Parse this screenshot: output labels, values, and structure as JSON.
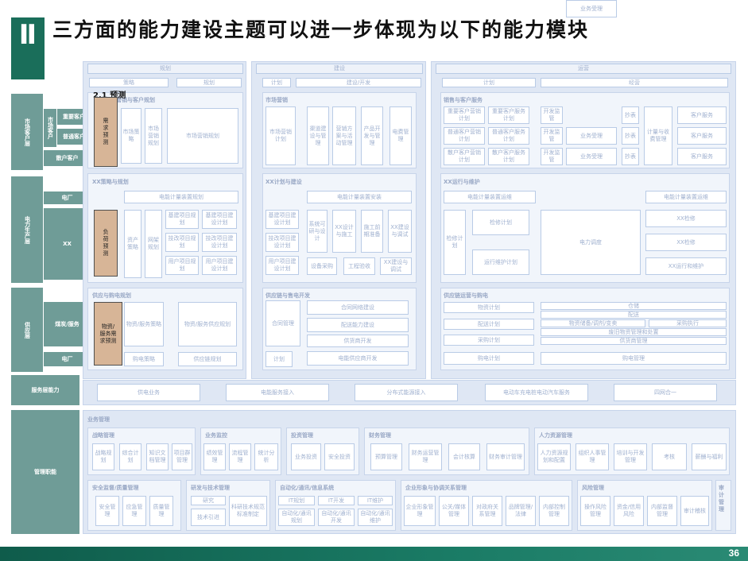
{
  "header": {
    "marker": "Ⅱ",
    "title": "三方面的能力建设主题可以进一步体现为以下的能力模块"
  },
  "callout": {
    "label": "2.1 预测"
  },
  "footer": {
    "page_number": "36"
  },
  "colors": {
    "teal": "#1a6e5a",
    "label_bg": "#6f9c97",
    "highlight": "#d7b597",
    "panel": "#dfe7f4"
  },
  "left_labels": {
    "market_customer": "市场客户层",
    "key_customer": "重要客户",
    "market_customer_item": "市场客户",
    "general_customer": "普通客户",
    "sparse_customer": "散户客户",
    "power_production": "电力生产层",
    "power_plant": "电厂",
    "xx": "XX",
    "supply": "供应层",
    "coal_supply": "煤炭/服务",
    "power_plant2": "电厂",
    "analysis": "服务层能力",
    "management": "管理职能"
  },
  "phases": {
    "planning": "规划",
    "construction": "建设",
    "operation": "运营"
  },
  "subphases": {
    "strategy": "策略",
    "plan": "规划",
    "plan2": "计划",
    "build": "建设/开发",
    "plan3": "计划",
    "operate": "经营"
  },
  "highlights": {
    "demand_forecast": "需求预测",
    "load_forecast": "负荷预测",
    "material_forecast": "物资/服务需求预测"
  },
  "sections": {
    "market": "市场营销与客户规划",
    "market_build": "市场营销",
    "sales_service": "销售与客户服务",
    "xx_plan": "XX策略与规划",
    "xx_build": "XX计划与建设",
    "xx_operate": "XX运行与维护",
    "supply_plan": "供应与购电规划",
    "supply_build": "供应链与售电开发",
    "supply_operate": "供应链运营与购电",
    "mgmt": "业务管理",
    "strategy_mgmt": "战略管理",
    "asset_mgmt": "业务监控",
    "invest_mgmt": "投资管理",
    "finance_mgmt": "财务管理",
    "hr_mgmt": "人力资源管理",
    "safety_mgmt": "安全监督/质量管理",
    "research_mgmt": "研发与技术管理",
    "it_mgmt": "自动化/通讯/信息系统",
    "enterprise_mgmt": "企业形象与协调关系管理",
    "risk_mgmt": "风险管理",
    "audit_mgmt": "审计管理"
  },
  "market_boxes": [
    "市场策略",
    "市场营销规划",
    "市场营销计划",
    "渠道建设与管理",
    "营销方案与活动管理",
    "产品开发与管理",
    "电费管理"
  ],
  "sales_boxes": [
    "重要客户营销计划",
    "重要客户服务计划",
    "普通客户营销计划",
    "普通客户服务计划",
    "散户客户营销计划",
    "散户客户服务计划",
    "开发监管",
    "业务受理",
    "抄表",
    "计量与收费管理",
    "客户服务"
  ],
  "xx_boxes": [
    "电能计量装置规划",
    "资产策略",
    "网架规划",
    "基建项目规划",
    "技改项目规划",
    "用户项目规划",
    "基建项目建设计划",
    "技改项目建设计划",
    "用户项目建设计划",
    "系统可研与设计",
    "XX设计与施工",
    "施工前期准备",
    "XX建设与调试",
    "电能计量装置安装",
    "设备采购",
    "工程验收",
    "电能计量装置运维",
    "检修计划",
    "运行维护计划",
    "电力调度",
    "XX检修",
    "XX运行和维护"
  ],
  "supply_boxes": [
    "物资/服务策略",
    "物资/服务供应规划",
    "购电策略",
    "供应链规划",
    "合同管理",
    "合同网络建设",
    "配送能力建设",
    "供货商开发",
    "电能供应商开发",
    "物资计划",
    "配送计划",
    "采购计划",
    "购电计划",
    "仓储",
    "配送",
    "物资储备/调剂/变卖",
    "采购执行",
    "废旧物资管理和处置",
    "供货商管理",
    "购电管理"
  ],
  "analysis_boxes": [
    "供电业务",
    "电能服务接入",
    "分布式能源接入",
    "电动车充电桩电动汽车服务",
    "四网合一"
  ],
  "mgmt_boxes": [
    "战略规划",
    "综合计划",
    "知识文档管理",
    "项目群管理",
    "绩效管理",
    "流程管理",
    "统计分析",
    "业务投资",
    "安全投资",
    "预算管理",
    "财务运营管理",
    "会计核算",
    "财务审计管理",
    "人力资源规划和配置",
    "组织人事管理",
    "培训与开发管理",
    "考核",
    "薪酬与福利",
    "安全管理",
    "应急管理",
    "质量管理",
    "研究",
    "技术引进",
    "科研技术规范标准制定",
    "IT规划",
    "IT开发",
    "IT维护",
    "自动化/通讯规划",
    "自动化/通讯开发",
    "自动化/通讯维护",
    "企业形象管理",
    "公关/媒体管理",
    "对政府关系管理",
    "品牌管理/法律",
    "内部控制管理",
    "操作风险管理",
    "资金/信用风险",
    "内部监督管理",
    "审计稽核"
  ]
}
